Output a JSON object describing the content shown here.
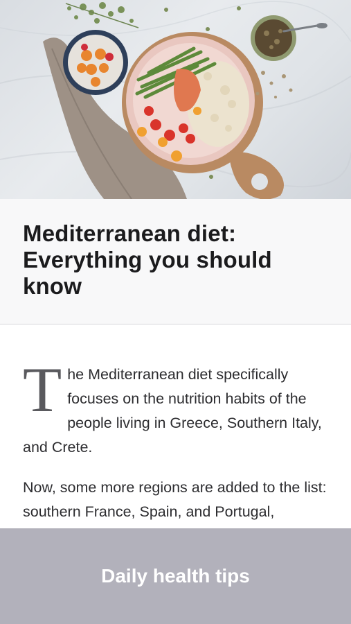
{
  "hero": {
    "image_name": "mediterranean-food-plate-photo"
  },
  "article": {
    "title": "Mediterranean diet: Everything you should know",
    "dropcap": "T",
    "paragraph1_rest": "he Mediterranean diet specifically focuses on the nutrition habits of the people living in Greece, Southern Italy, and Crete.",
    "paragraph2": "Now, some more regions are added to the list: southern France, Spain, and Portugal,"
  },
  "footer": {
    "label": "Daily health tips"
  },
  "colors": {
    "footer_bg": "#b2b1bb",
    "title_text": "#1b1b1d",
    "dropcap": "#5a5a5e"
  }
}
